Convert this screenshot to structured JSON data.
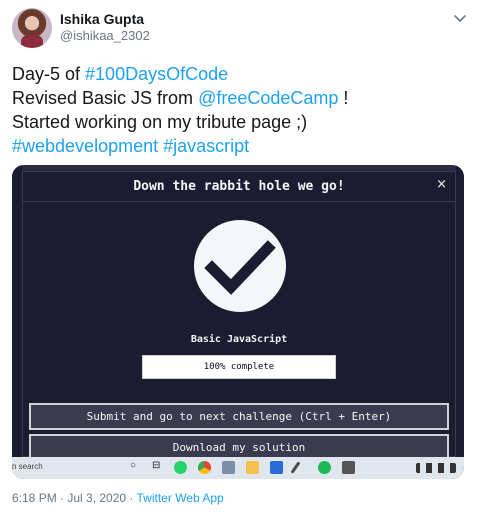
{
  "tweet": {
    "author_name": "Ishika Gupta",
    "handle": "@ishikaa_2302",
    "text": {
      "line1_prefix": "Day-5 of ",
      "line1_hashtag": "#100DaysOfCode",
      "line2_prefix": "Revised Basic JS from ",
      "line2_mention": "@freeCodeCamp",
      "line2_suffix": " !",
      "line3": "Started working on my tribute page ;)",
      "line4_hashtag1": "#webdevelopment",
      "line4_hashtag2": "#javascript"
    },
    "timestamp": "6:18 PM · Jul 3, 2020 · ",
    "source": "Twitter Web App"
  },
  "screenshot": {
    "modal": {
      "title": "Down the rabbit hole we go!",
      "close": "×",
      "challenge": "Basic JavaScript",
      "progress_label": "100% complete",
      "progress_fraction": 1.0,
      "submit_button": "Submit and go to next challenge (Ctrl + Enter)",
      "download_button": "Download my solution"
    },
    "taskbar": {
      "search_text": "n search",
      "cortana_symbol": "○",
      "task_view_symbol": "⊟"
    }
  },
  "colors": {
    "fcc_dark": "#1b1b32",
    "fcc_gray": "#3b3b4f",
    "twitter_blue": "#1da1f2",
    "muted": "#657786"
  },
  "icons": [
    "avatar-photo",
    "chevron-down-icon",
    "checkmark-icon",
    "close-icon",
    "whatsapp-icon",
    "chrome-icon",
    "spotify-icon"
  ]
}
